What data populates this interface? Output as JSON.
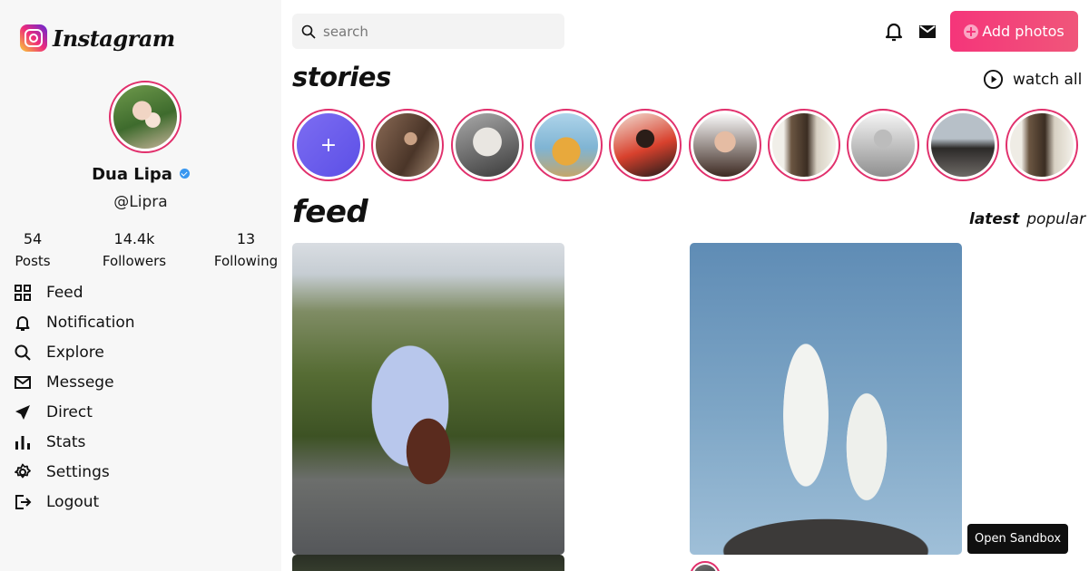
{
  "brand": {
    "logo_text": "Instagram",
    "accent": "#e1306c",
    "button_gradient": [
      "#f5357a",
      "#f0567a"
    ]
  },
  "profile": {
    "name": "Dua Lipa",
    "handle": "@Lipra",
    "verified": true,
    "stats": [
      {
        "value": "54",
        "label": "Posts"
      },
      {
        "value": "14.4k",
        "label": "Followers"
      },
      {
        "value": "13",
        "label": "Following"
      }
    ]
  },
  "nav": [
    {
      "label": "Feed",
      "icon": "grid-icon"
    },
    {
      "label": "Notification",
      "icon": "bell-icon"
    },
    {
      "label": "Explore",
      "icon": "search-icon"
    },
    {
      "label": "Messege",
      "icon": "mail-icon"
    },
    {
      "label": "Direct",
      "icon": "send-icon"
    },
    {
      "label": "Stats",
      "icon": "bar-chart-icon"
    },
    {
      "label": "Settings",
      "icon": "gear-icon"
    },
    {
      "label": "Logout",
      "icon": "logout-icon"
    }
  ],
  "header": {
    "search_placeholder": "search",
    "add_photos_label": "Add photos"
  },
  "stories": {
    "title": "stories",
    "watch_all_label": "watch all",
    "add_symbol": "+"
  },
  "feed": {
    "title": "feed",
    "tabs": [
      {
        "label": "latest",
        "active": true
      },
      {
        "label": "popular",
        "active": false
      }
    ]
  },
  "sandbox": {
    "label": "Open Sandbox"
  }
}
